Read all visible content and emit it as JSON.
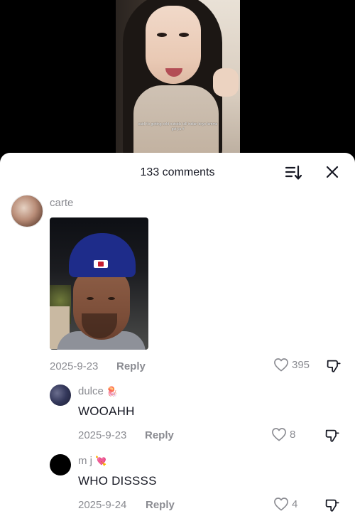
{
  "video": {
    "caption": "said it's getting cold outside tall indian boys lemme get ya #"
  },
  "sheet": {
    "comment_count": "133 comments",
    "sort_icon": "sort-icon",
    "close_icon": "close-icon"
  },
  "comments": [
    {
      "username": "carte",
      "text": "",
      "has_photo": true,
      "date": "2025-9-23",
      "reply_label": "Reply",
      "likes": "395"
    },
    {
      "username": "dulce",
      "username_emoji": "🪼",
      "text": "WOOAHH",
      "date": "2025-9-23",
      "reply_label": "Reply",
      "likes": "8"
    },
    {
      "username": "m j",
      "username_emoji": "💘",
      "text": "WHO DISSSS",
      "date": "2025-9-24",
      "reply_label": "Reply",
      "likes": "4"
    }
  ],
  "colors": {
    "text_primary": "#161823",
    "text_secondary": "#8a8b91",
    "sheet_bg": "#ffffff",
    "video_bg": "#000000"
  }
}
